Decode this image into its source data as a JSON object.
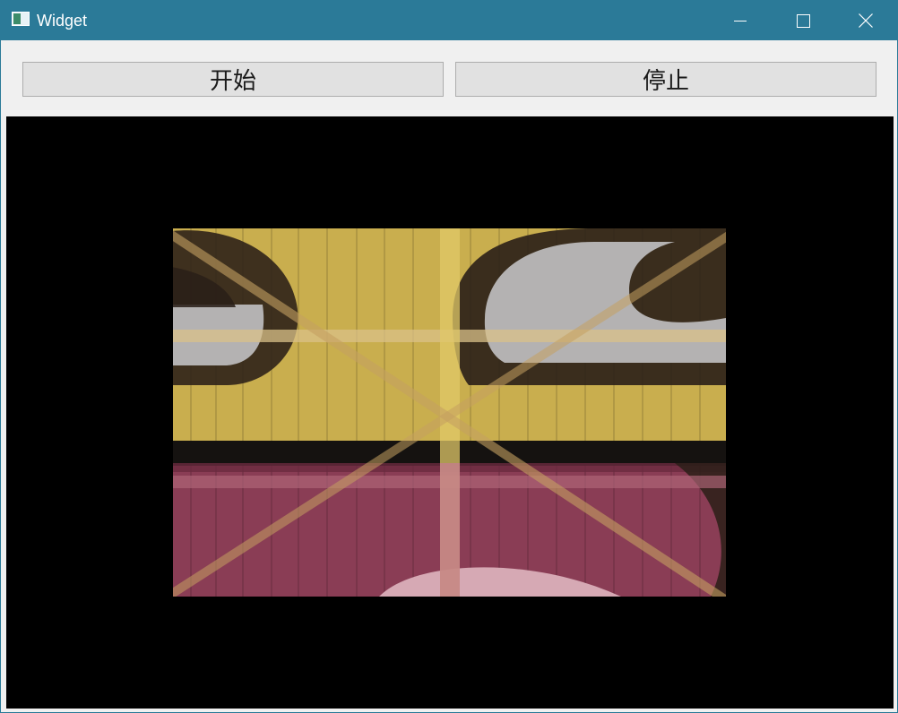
{
  "window": {
    "title": "Widget",
    "title_bar_color": "#2b7a98",
    "icons": {
      "app": "app-window-icon",
      "minimize": "minimize-icon",
      "maximize": "maximize-icon",
      "close": "close-icon"
    }
  },
  "toolbar": {
    "start_label": "开始",
    "stop_label": "停止"
  },
  "video": {
    "background_color": "#000000",
    "frame_colors": {
      "top": "#c9ae4e",
      "bottom": "#8a3d55",
      "stripe": "#151210",
      "eye": "#b4b2b2",
      "pupil": "#2a1f18"
    }
  }
}
